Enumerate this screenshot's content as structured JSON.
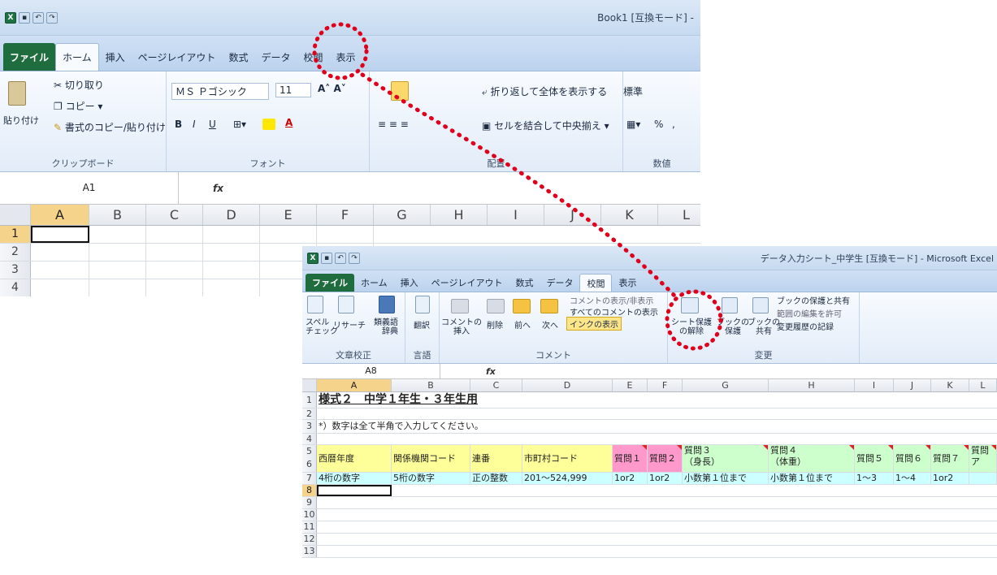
{
  "window1": {
    "title": "Book1 [互換モード] -",
    "tabs": [
      "ファイル",
      "ホーム",
      "挿入",
      "ページレイアウト",
      "数式",
      "データ",
      "校閲",
      "表示"
    ],
    "clipboard": {
      "paste": "貼り付け",
      "cut": "切り取り",
      "copy": "コピー",
      "format_painter": "書式のコピー/貼り付け",
      "label": "クリップボード"
    },
    "font": {
      "name": "ＭＳ Ｐゴシック",
      "size": "11",
      "label": "フォント",
      "bold": "B",
      "italic": "I",
      "underline": "U"
    },
    "alignment": {
      "wrap": "折り返して全体を表示する",
      "merge": "セルを結合して中央揃え",
      "label": "配置"
    },
    "number": {
      "format": "標準",
      "pct": "%",
      "comma": ",",
      "label": "数値"
    },
    "namebox": "A1",
    "fx": "fx",
    "columns": [
      "A",
      "B",
      "C",
      "D",
      "E",
      "F",
      "G",
      "H",
      "I",
      "J",
      "K",
      "L"
    ],
    "rows": [
      "1",
      "2",
      "3",
      "4"
    ]
  },
  "window2": {
    "title": "データ入力シート_中学生 [互換モード] - Microsoft Excel",
    "tabs": [
      "ファイル",
      "ホーム",
      "挿入",
      "ページレイアウト",
      "数式",
      "データ",
      "校閲",
      "表示"
    ],
    "groups": {
      "proofing": {
        "spell1": "スペル",
        "spell2": "チェック",
        "research": "リサーチ",
        "thesaurus1": "類義語",
        "thesaurus2": "辞典",
        "label": "文章校正"
      },
      "language": {
        "translate": "翻訳",
        "label": "言語"
      },
      "comments": {
        "new1": "コメントの",
        "new2": "挿入",
        "delete": "削除",
        "prev": "前へ",
        "next": "次へ",
        "show_hide": "コメントの表示/非表示",
        "show_all": "すべてのコメントの表示",
        "ink": "インクの表示",
        "label": "コメント"
      },
      "changes": {
        "unprotect1": "シート保護",
        "unprotect2": "の解除",
        "protect_book1": "ブックの",
        "protect_book2": "保護",
        "share1": "ブックの",
        "share2": "共有",
        "protect_share": "ブックの保護と共有",
        "allow_edit": "範囲の編集を許可",
        "track": "変更履歴の記録",
        "label": "変更"
      }
    },
    "namebox": "A8",
    "fx": "fx",
    "columns": [
      "A",
      "B",
      "C",
      "D",
      "E",
      "F",
      "G",
      "H",
      "I",
      "J",
      "K",
      "L"
    ],
    "rows": [
      "1",
      "2",
      "3",
      "4",
      "5",
      "6",
      "7",
      "8",
      "9",
      "10",
      "11",
      "12",
      "13"
    ],
    "cells": {
      "title": "様式２　中学１年生・３年生用",
      "note": "*）数字は全て半角で入力してください。",
      "headers": [
        "西暦年度",
        "関係機関コード",
        "連番",
        "市町村コード",
        "質問１",
        "質問２",
        "質問３",
        "質問４",
        "質問５",
        "質問６",
        "質問７",
        "質問"
      ],
      "subheaders": {
        "g": "（身長）",
        "h": "（体重）",
        "l": "ア"
      },
      "row7": [
        "4桁の数字",
        "5桁の数字",
        "正の整数",
        "201～524,999",
        "1or2",
        "1or2",
        "小数第１位まで",
        "小数第１位まで",
        "1～3",
        "1～4",
        "1or2",
        ""
      ]
    }
  },
  "colors": {
    "highlight_circle": "#e0001b",
    "yellow": "#ffff99",
    "pink": "#ff99cc",
    "green": "#ccffcc",
    "cyan": "#ccffff"
  }
}
